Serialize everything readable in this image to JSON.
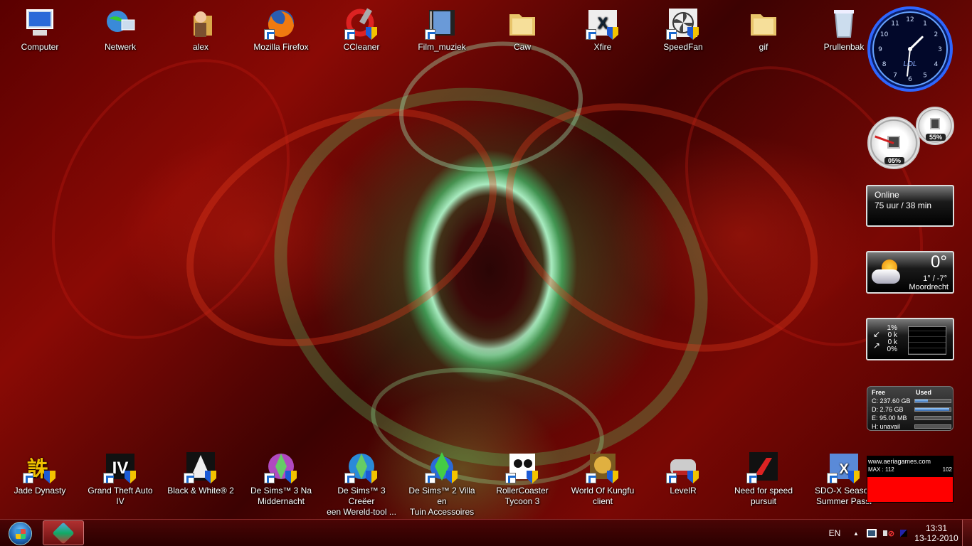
{
  "desktop_icons_top": [
    {
      "label": "Computer",
      "icon": "computer-icon"
    },
    {
      "label": "Netwerk",
      "icon": "network-icon"
    },
    {
      "label": "alex",
      "icon": "user-folder-icon"
    },
    {
      "label": "Mozilla Firefox",
      "icon": "firefox-icon"
    },
    {
      "label": "CCleaner",
      "icon": "ccleaner-icon"
    },
    {
      "label": "Film_muziek",
      "icon": "film-icon"
    },
    {
      "label": "Caw",
      "icon": "folder-icon"
    },
    {
      "label": "Xfire",
      "icon": "xfire-icon"
    },
    {
      "label": "SpeedFan",
      "icon": "speedfan-icon"
    },
    {
      "label": "gif",
      "icon": "folder-icon"
    },
    {
      "label": "Prullenbak",
      "icon": "recycle-bin-icon"
    }
  ],
  "desktop_icons_bottom": [
    {
      "line1": "Jade Dynasty",
      "line2": "",
      "icon": "jade-dynasty-icon"
    },
    {
      "line1": "Grand Theft Auto IV",
      "line2": "",
      "icon": "gta-iv-icon"
    },
    {
      "line1": "Black & White® 2",
      "line2": "",
      "icon": "black-white-2-icon"
    },
    {
      "line1": "De Sims™ 3 Na",
      "line2": "Middernacht",
      "icon": "sims3-night-icon"
    },
    {
      "line1": "De Sims™ 3 Creëer",
      "line2": "een Wereld-tool ...",
      "icon": "sims3-create-world-icon"
    },
    {
      "line1": "De Sims™ 2 Villa en",
      "line2": "Tuin Accessoires",
      "icon": "sims2-villa-icon"
    },
    {
      "line1": "RollerCoaster",
      "line2": "Tycoon 3",
      "icon": "rollercoaster-icon"
    },
    {
      "line1": "World Of Kungfu",
      "line2": "client",
      "icon": "kungfu-icon"
    },
    {
      "line1": "LevelR",
      "line2": "",
      "icon": "levelr-icon"
    },
    {
      "line1": "Need for speed",
      "line2": "pursuit",
      "icon": "nfs-icon"
    },
    {
      "line1": "SDO-X Season",
      "line2": "Summer Passi",
      "icon": "sdox-icon"
    }
  ],
  "gadgets": {
    "clock": {
      "brand": "LOL",
      "hour": 1,
      "minute": 31
    },
    "cpu_meter": {
      "cpu": "05%",
      "memory": "55%"
    },
    "online": {
      "title": "Online",
      "value": "75 uur / 38 min"
    },
    "weather": {
      "temp": "0°",
      "range": "1° / -7°",
      "city": "Moordrecht"
    },
    "network": {
      "rows": [
        "1%",
        "0 k",
        "0 k",
        "0%"
      ]
    },
    "drives": {
      "header_free": "Free",
      "header_used": "Used",
      "rows": [
        {
          "label": "C:  237.60 GB",
          "used": 0.35
        },
        {
          "label": "D:  2.76 GB",
          "used": 0.95
        },
        {
          "label": "E:  95.00 MB",
          "used": 0.0
        },
        {
          "label": "H:  unavail",
          "used": 0.0
        }
      ]
    },
    "ping": {
      "site": "www.aeriagames.com",
      "max": "MAX : 112",
      "current": "102"
    }
  },
  "taskbar": {
    "language": "EN",
    "time": "13:31",
    "date": "13-12-2010"
  },
  "colors": {
    "wallpaper_dark": "#3a0000",
    "glow_green": "#5bf28a",
    "ping_bar": "#ff0000"
  }
}
